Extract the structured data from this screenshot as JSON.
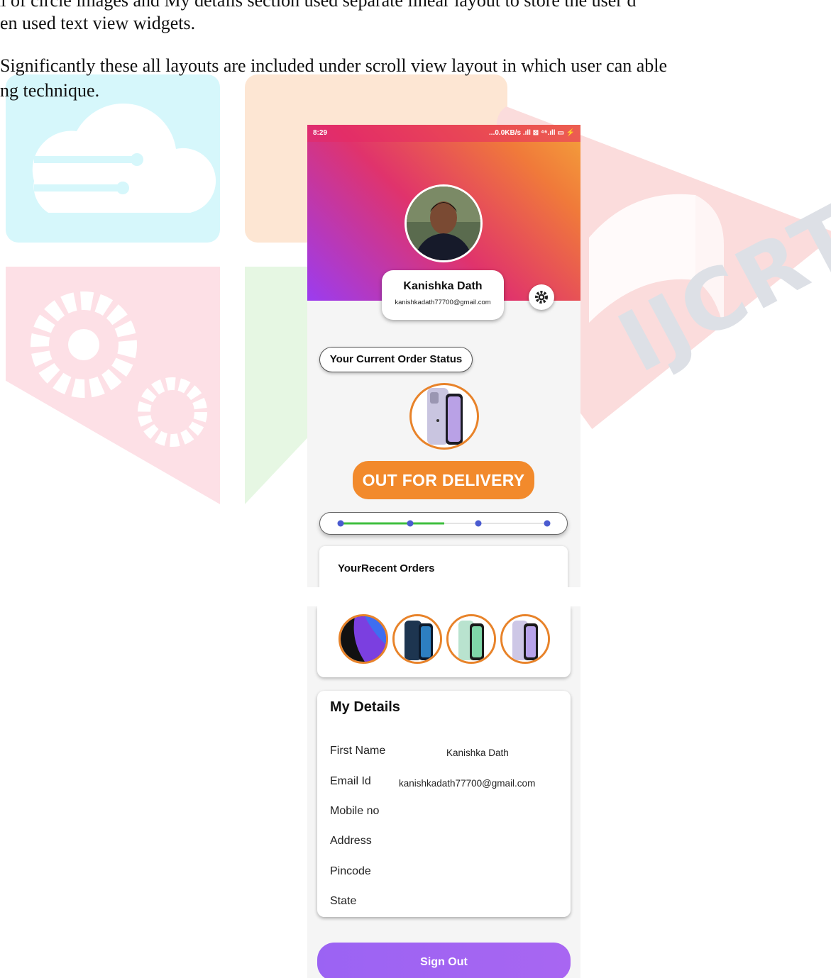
{
  "document": {
    "line1": "ll of circle images and My details section used separate linear layout  to store the user d",
    "line2": "en used text view widgets.",
    "line3": "Significantly these all layouts are included under scroll view layout in which user can able",
    "line4": "ng technique."
  },
  "watermark": {
    "text": "IJCRT"
  },
  "statusbar": {
    "time": "8:29",
    "indicators": "...0.0KB/s .ıll ⊠ ⁴⁶.ıll ▭ ⚡"
  },
  "profile": {
    "name": "Kanishka Dath",
    "email": "kanishkadath77700@gmail.com"
  },
  "order": {
    "status_heading": "Your Current Order Status",
    "status_label": "OUT FOR DELIVERY",
    "progress_completed_steps": 2,
    "progress_total_steps": 4
  },
  "recent_orders": {
    "title": "YourRecent Orders",
    "items": [
      "phone-purple",
      "phone-blue",
      "phone-green",
      "phone-lilac"
    ]
  },
  "my_details": {
    "title": "My Details",
    "rows": [
      {
        "label": "First Name",
        "value": "Kanishka Dath"
      },
      {
        "label": "Email Id",
        "value": "kanishkadath77700@gmail.com"
      },
      {
        "label": "Mobile no",
        "value": ""
      },
      {
        "label": "Address",
        "value": ""
      },
      {
        "label": "Pincode",
        "value": ""
      },
      {
        "label": "State",
        "value": ""
      }
    ]
  },
  "actions": {
    "sign_out": "Sign Out"
  },
  "colors": {
    "accent_orange": "#f28a2c",
    "progress_green": "#3fbf3f",
    "progress_dot": "#4a5bd0",
    "sign_out_purple": "#9b63f3"
  }
}
